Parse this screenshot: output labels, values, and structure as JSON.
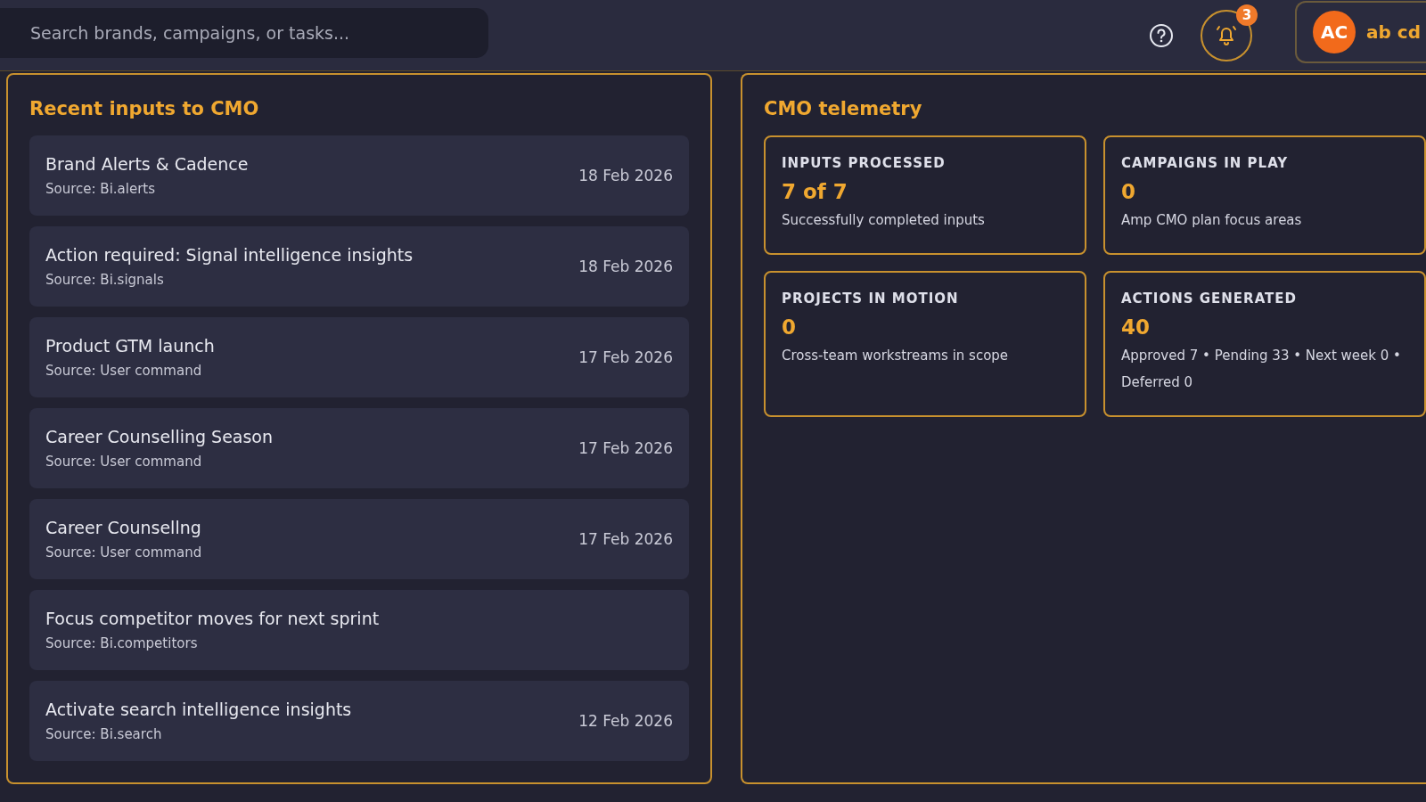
{
  "search": {
    "placeholder": "Search brands, campaigns, or tasks..."
  },
  "notifications": {
    "count": "3"
  },
  "profile": {
    "initials": "AC",
    "name": "ab cd"
  },
  "recent_inputs": {
    "title": "Recent inputs to CMO",
    "items": [
      {
        "title": "Brand Alerts & Cadence",
        "source": "Source: Bi.alerts",
        "date": "18 Feb 2026"
      },
      {
        "title": "Action required: Signal intelligence insights",
        "source": "Source: Bi.signals",
        "date": "18 Feb 2026"
      },
      {
        "title": "Product GTM launch",
        "source": "Source: User command",
        "date": "17 Feb 2026"
      },
      {
        "title": "Career Counselling Season",
        "source": "Source: User command",
        "date": "17 Feb 2026"
      },
      {
        "title": "Career Counsellng",
        "source": "Source: User command",
        "date": "17 Feb 2026"
      },
      {
        "title": "Focus competitor moves for next sprint",
        "source": "Source: Bi.competitors"
      },
      {
        "title": "Activate search intelligence insights",
        "source": "Source: Bi.search",
        "date": "12 Feb 2026"
      }
    ]
  },
  "telemetry": {
    "title": "CMO telemetry",
    "cards": [
      {
        "label": "INPUTS PROCESSED",
        "value": "7 of 7",
        "note": "Successfully completed inputs"
      },
      {
        "label": "CAMPAIGNS IN PLAY",
        "value": "0",
        "note": "Amp CMO plan focus areas"
      },
      {
        "label": "PROJECTS IN MOTION",
        "value": "0",
        "note": "Cross-team workstreams in scope"
      },
      {
        "label": "ACTIONS GENERATED",
        "value": "40",
        "note": "Approved 7 • Pending 33 • Next week 0 • Deferred 0"
      }
    ]
  }
}
